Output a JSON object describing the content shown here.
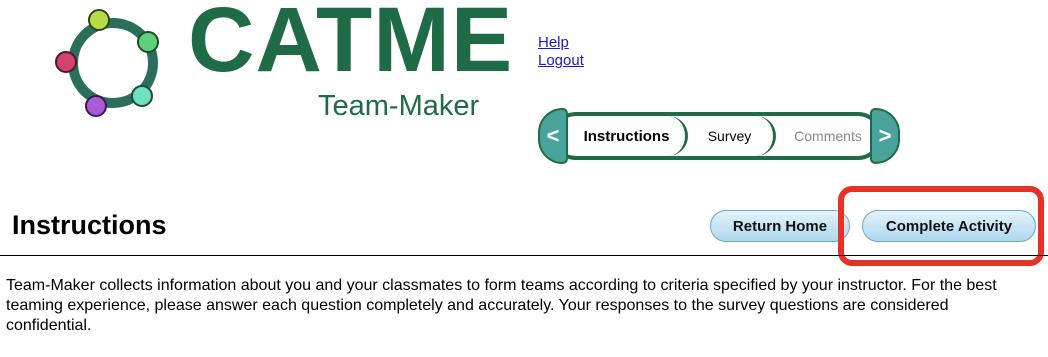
{
  "header": {
    "brand": "CATME",
    "subtitle": "Team-Maker",
    "links": {
      "help": "Help",
      "logout": "Logout"
    }
  },
  "stepper": {
    "prev": "<",
    "next": ">",
    "steps": [
      {
        "label": "Instructions",
        "state": "active"
      },
      {
        "label": "Survey",
        "state": "default"
      },
      {
        "label": "Comments",
        "state": "disabled"
      }
    ]
  },
  "main": {
    "heading": "Instructions",
    "buttons": {
      "return_home": "Return Home",
      "complete_activity": "Complete Activity"
    },
    "intro": "Team-Maker collects information about you and your classmates to form teams according to criteria specified by your instructor. For the best teaming experience, please answer each question completely and accurately. Your responses to the survey questions are considered confidential."
  },
  "colors": {
    "brand_green": "#1f6b46",
    "arrow_teal": "#4aa39b",
    "link_blue": "#1a1ac8",
    "button_blue": "#aed7ee",
    "highlight_red": "#e63224"
  }
}
